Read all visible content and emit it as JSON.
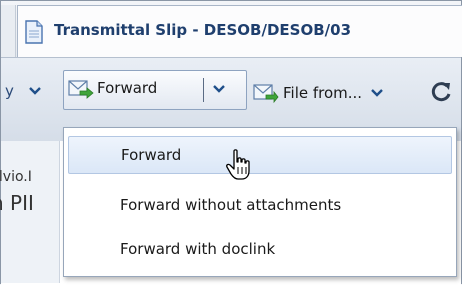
{
  "tab": {
    "title": "Transmittal Slip - DESOB/DESOB/03"
  },
  "toolbar": {
    "cut_left_text": "y",
    "forward_label": "Forward",
    "file_from_label": "File from..."
  },
  "content": {
    "sender_fragment": "ilvio.I",
    "subject_fragment": "n PII"
  },
  "forward_menu": {
    "items": [
      {
        "label": "Forward"
      },
      {
        "label": "Forward without attachments"
      },
      {
        "label": "Forward with doclink"
      }
    ]
  },
  "colors": {
    "title_text": "#1f3f6e",
    "highlight": "#dbe7f7",
    "toolbar_bg": "#d5dde8"
  },
  "icons": [
    "document-icon",
    "forward-mail-icon",
    "chevron-down-icon",
    "file-mail-icon",
    "refresh-icon",
    "hand-cursor-icon"
  ]
}
